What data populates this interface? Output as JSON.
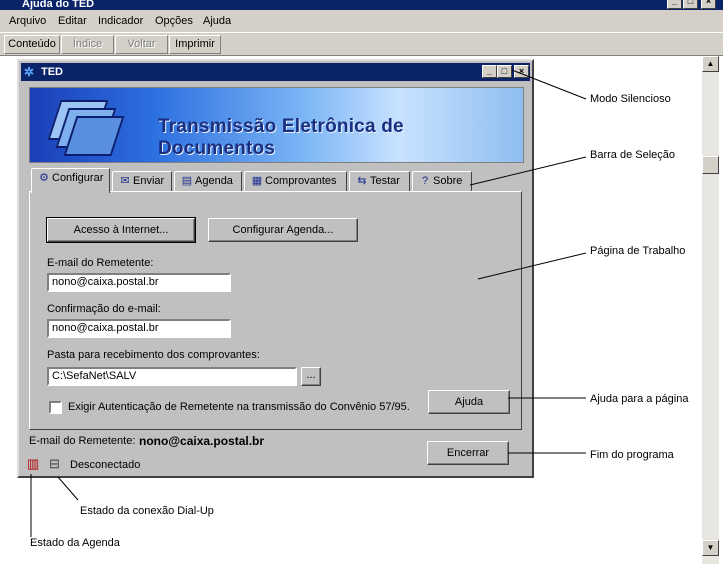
{
  "help_window": {
    "title": "Ajuda do TED",
    "controls": [
      "_",
      "□",
      "×"
    ],
    "menu": [
      "Arquivo",
      "Editar",
      "Indicador",
      "Opções",
      "Ajuda"
    ],
    "toolbar": [
      {
        "label": "Conteúdo",
        "enabled": true
      },
      {
        "label": "Índice",
        "enabled": false
      },
      {
        "label": "Voltar",
        "enabled": false
      },
      {
        "label": "Imprimir",
        "enabled": true
      }
    ],
    "scroll_up": "▲",
    "scroll_down": "▼"
  },
  "ted": {
    "title": "TED",
    "controls": [
      "_",
      "□",
      "×"
    ],
    "banner_text": "Transmissão Eletrônica de Documentos",
    "tabs": [
      {
        "label": "Configurar",
        "icon": "gear-icon",
        "active": true
      },
      {
        "label": "Enviar",
        "icon": "send-icon",
        "active": false
      },
      {
        "label": "Agenda",
        "icon": "agenda-icon",
        "active": false
      },
      {
        "label": "Comprovantes",
        "icon": "receipts-icon",
        "active": false
      },
      {
        "label": "Testar",
        "icon": "test-icon",
        "active": false
      },
      {
        "label": "Sobre",
        "icon": "question-icon",
        "active": false
      }
    ],
    "buttons": {
      "internet": "Acesso à Internet...",
      "agenda": "Configurar Agenda...",
      "browse": "...",
      "help": "Ajuda",
      "exit": "Encerrar"
    },
    "email_label": "E-mail do Remetente:",
    "email_value": "nono@caixa.postal.br",
    "confirm_label": "Confirmação do e-mail:",
    "confirm_value": "nono@caixa.postal.br",
    "folder_label": "Pasta para recebimento dos comprovantes:",
    "folder_value": "C:\\SefaNet\\SALV",
    "auth_checkbox": {
      "label": "Exigir Autenticação de Remetente na transmissão do Convênio 57/95.",
      "checked": false
    },
    "status_email_label": "E-mail do Remetente:",
    "status_email_value": "nono@caixa.postal.br",
    "connection_status": "Desconectado"
  },
  "annotations": {
    "silent_mode": "Modo Silencioso",
    "selection_bar": "Barra de Seleção",
    "work_page": "Página de Trabalho",
    "page_help": "Ajuda para a página",
    "end_program": "Fim do programa",
    "dialup_state": "Estado da conexão Dial-Up",
    "agenda_state": "Estado da Agenda"
  },
  "colors": {
    "titlebar": "#0a246a",
    "window_face": "#c0c0c0"
  }
}
